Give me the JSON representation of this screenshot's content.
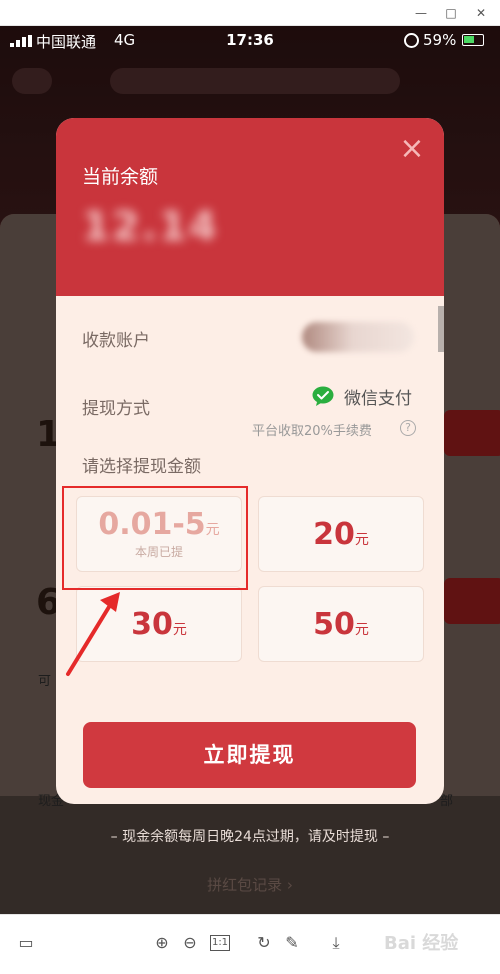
{
  "window": {
    "minimize": "—",
    "maximize": "□",
    "close": "✕"
  },
  "status_bar": {
    "carrier": "中国联通",
    "network": "4G",
    "time": "17:36",
    "battery": "59%",
    "battery_level": 0.59
  },
  "modal": {
    "balance_label": "当前余额",
    "balance_value": "12.14",
    "account_label": "收款账户",
    "method_label": "提现方式",
    "method_value": "微信支付",
    "method_icon": "wechat-icon",
    "fee_note": "平台收取20%手续费",
    "help": "?",
    "amount_prompt": "请选择提现金额",
    "amounts": [
      {
        "value": "0.01-5",
        "unit": "元",
        "note": "本周已提"
      },
      {
        "value": "20",
        "unit": "元"
      },
      {
        "value": "30",
        "unit": "元"
      },
      {
        "value": "50",
        "unit": "元"
      }
    ],
    "submit_label": "立即提现",
    "close_icon": "×"
  },
  "page": {
    "footer_note": "– 现金余额每周日晚24点过期，请及时提现 –",
    "history_link": "拼红包记录 ›"
  },
  "toolbar": {
    "zoom_label": "1:1",
    "watermark": "Bai 经验"
  },
  "colors": {
    "accent": "#c9353c",
    "modal_bg": "#fdeee6",
    "annotation": "#e52a2a"
  }
}
